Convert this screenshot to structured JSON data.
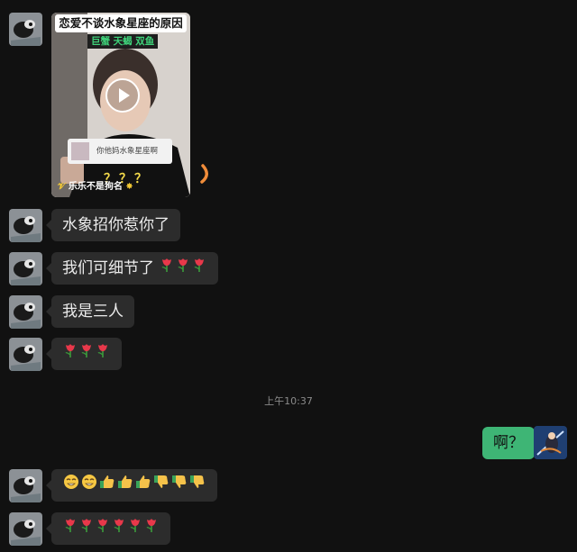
{
  "video": {
    "title": "恋爱不谈水象星座的原因",
    "tags": "巨蟹 天蝎 双鱼",
    "comment": "你他妈水象星座啊",
    "qmarks": "？？？",
    "author": "乐乐不是狗名"
  },
  "messages": [
    {
      "text": "水象招你惹你了"
    },
    {
      "text": "我们可细节了",
      "emoji": [
        "tulip",
        "tulip",
        "tulip"
      ]
    },
    {
      "text": "我是三人"
    },
    {
      "text": "",
      "emoji": [
        "tulip",
        "tulip",
        "tulip"
      ]
    }
  ],
  "timestamp": "上午10:37",
  "my_message": "啊？",
  "later_messages": [
    {
      "emoji": [
        "grin",
        "grin",
        "thumbs-up",
        "thumbs-up",
        "thumbs-up",
        "thumbs-down",
        "thumbs-down",
        "thumbs-down"
      ]
    },
    {
      "emoji": [
        "tulip",
        "tulip",
        "tulip",
        "tulip",
        "tulip",
        "tulip"
      ]
    }
  ],
  "colors": {
    "background": "#111111",
    "bubble": "#2c2c2c",
    "my_bubble": "#3eb575",
    "timestamp": "#8a8a8a"
  }
}
